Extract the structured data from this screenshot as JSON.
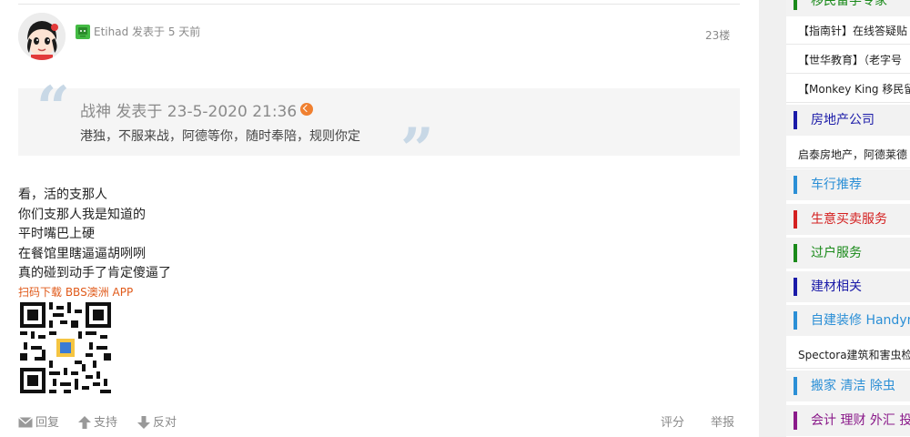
{
  "post": {
    "author": "Etihad",
    "posted_text": "发表于 5 天前",
    "floor": "23楼",
    "quote": {
      "head": "战神 发表于 23-5-2020 21:36",
      "body": "港独，不服来战，阿德等你，随时奉陪，规则你定"
    },
    "content_lines": [
      "看，活的支那人",
      "你们支那人我是知道的",
      "平时嘴巴上硬",
      "在餐馆里瞎逼逼胡咧咧",
      "真的碰到动手了肯定傻逼了"
    ],
    "app_link": "扫码下载 BBS澳洲 APP",
    "actions": {
      "reply": "回复",
      "support": "支持",
      "oppose": "反对",
      "rate": "评分",
      "report": "举报"
    }
  },
  "sidebar": {
    "items": [
      {
        "type": "head",
        "label": "移民留学专家",
        "color": "#1a8a1a"
      },
      {
        "type": "item",
        "label": "【指南针】在线答疑贴"
      },
      {
        "type": "item",
        "label": "【世华教育】（老字号"
      },
      {
        "type": "item",
        "label": "【Monkey King 移民留"
      },
      {
        "type": "head",
        "label": "房地产公司",
        "color": "#1a1aa8"
      },
      {
        "type": "item",
        "label": "启泰房地产，阿德莱德"
      },
      {
        "type": "head",
        "label": "车行推荐",
        "color": "#2b8fd6"
      },
      {
        "type": "head",
        "label": "生意买卖服务",
        "color": "#d42020"
      },
      {
        "type": "head",
        "label": "过户服务",
        "color": "#1a8a1a"
      },
      {
        "type": "head",
        "label": "建材相关",
        "color": "#1a1aa8"
      },
      {
        "type": "head",
        "label": "自建装修 Handyman",
        "color": "#2b8fd6"
      },
      {
        "type": "item",
        "label": "Spectora建筑和害虫检"
      },
      {
        "type": "head",
        "label": "搬家 清洁 除虫",
        "color": "#2b8fd6"
      },
      {
        "type": "head",
        "label": "会计 理财 外汇 投资",
        "color": "#8a1a8a"
      }
    ]
  },
  "colors": {
    "link_orange": "#e05a1a",
    "meta_gray": "#8a8a8a",
    "quote_bg": "#f5f5f5",
    "online_green": "#44bb44"
  },
  "icons": [
    "online-status-icon",
    "goto-quote-icon",
    "reply-mail-icon",
    "support-arrow-up-icon",
    "oppose-arrow-down-icon",
    "qr-code-image"
  ]
}
